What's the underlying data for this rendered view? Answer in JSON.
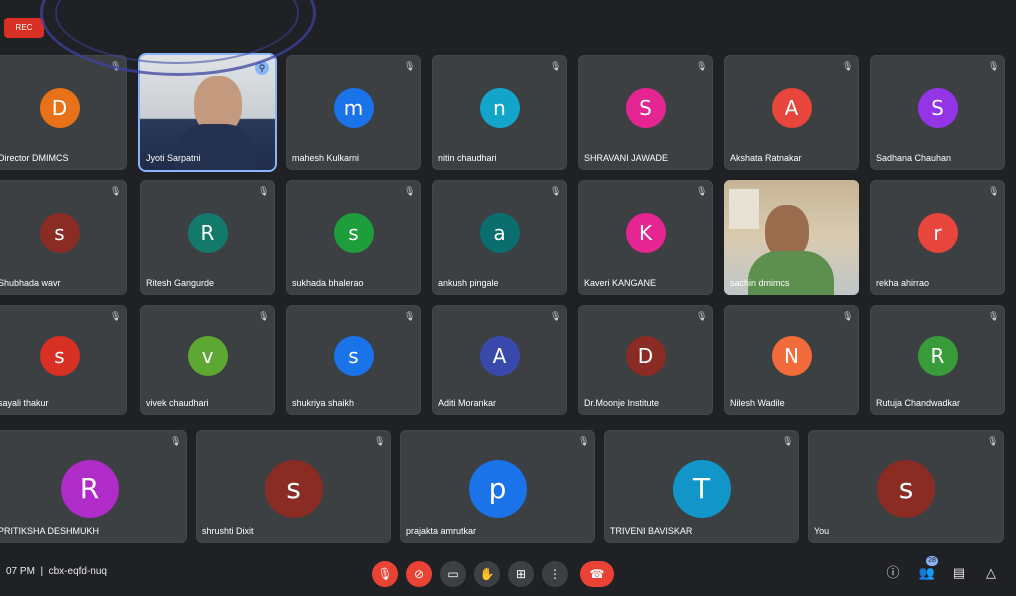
{
  "recording_label": "REC",
  "meeting": {
    "time": "07 PM",
    "code": "cbx-eqfd-nuq"
  },
  "tiles": [
    {
      "name": "Director DMIMCS",
      "letter": "D",
      "color": "#e8711a"
    },
    {
      "name": "Jyoti Sarpatni",
      "video": true
    },
    {
      "name": "mahesh Kulkarni",
      "letter": "m",
      "color": "#1a73e8"
    },
    {
      "name": "nitin chaudhari",
      "letter": "n",
      "color": "#12a4c9"
    },
    {
      "name": "SHRAVANI JAWADE",
      "letter": "S",
      "color": "#e52592"
    },
    {
      "name": "Akshata Ratnakar",
      "letter": "A",
      "color": "#e8453c"
    },
    {
      "name": "Sadhana Chauhan",
      "letter": "S",
      "color": "#9334e6"
    },
    {
      "name": "Shubhada wavr",
      "letter": "s",
      "color": "#8b2c24"
    },
    {
      "name": "Ritesh Gangurde",
      "letter": "R",
      "color": "#137a6b"
    },
    {
      "name": "sukhada bhalerao",
      "letter": "s",
      "color": "#1e9e3a"
    },
    {
      "name": "ankush pingale",
      "letter": "a",
      "color": "#0b6e6e"
    },
    {
      "name": "Kaveri KANGANE",
      "letter": "K",
      "color": "#e52592"
    },
    {
      "name": "sachin dmimcs",
      "video": true
    },
    {
      "name": "rekha ahirrao",
      "letter": "r",
      "color": "#e8453c"
    },
    {
      "name": "sayali thakur",
      "letter": "s",
      "color": "#d93025"
    },
    {
      "name": "vivek chaudhari",
      "letter": "v",
      "color": "#5da832"
    },
    {
      "name": "shukriya shaikh",
      "letter": "s",
      "color": "#1a73e8"
    },
    {
      "name": "Aditi Morankar",
      "letter": "A",
      "color": "#3949ab"
    },
    {
      "name": "Dr.Moonje Institute",
      "letter": "D",
      "color": "#8b2c24"
    },
    {
      "name": "Nilesh Wadile",
      "letter": "N",
      "color": "#f26b3a"
    },
    {
      "name": "Rutuja Chandwadkar",
      "letter": "R",
      "color": "#3a9b3a"
    },
    {
      "name": "PRITIKSHA DESHMUKH",
      "letter": "R",
      "color": "#b02cc9"
    },
    {
      "name": "shrushti Dixit",
      "letter": "s",
      "color": "#8b2c24"
    },
    {
      "name": "prajakta amrutkar",
      "letter": "p",
      "color": "#1a73e8"
    },
    {
      "name": "TRIVENI BAVISKAR",
      "letter": "T",
      "color": "#1296c9"
    },
    {
      "name": "You",
      "letter": "s",
      "color": "#8b2c24"
    }
  ],
  "controls": [
    {
      "icon": "mic-off-icon",
      "glyph": "🎙",
      "red": true
    },
    {
      "icon": "camera-off-icon",
      "glyph": "⊘",
      "red": true
    },
    {
      "icon": "captions-icon",
      "glyph": "▭",
      "red": false
    },
    {
      "icon": "raise-hand-icon",
      "glyph": "✋",
      "red": false
    },
    {
      "icon": "present-icon",
      "glyph": "⊞",
      "red": false
    },
    {
      "icon": "more-options-icon",
      "glyph": "⋮",
      "red": false
    },
    {
      "icon": "end-call-icon",
      "glyph": "☎",
      "red": true
    }
  ],
  "right_icons": [
    {
      "icon": "info-icon",
      "glyph": "ⓘ"
    },
    {
      "icon": "people-icon",
      "glyph": "👥",
      "badge": "28"
    },
    {
      "icon": "chat-icon",
      "glyph": "▤"
    },
    {
      "icon": "activities-icon",
      "glyph": "△"
    }
  ]
}
